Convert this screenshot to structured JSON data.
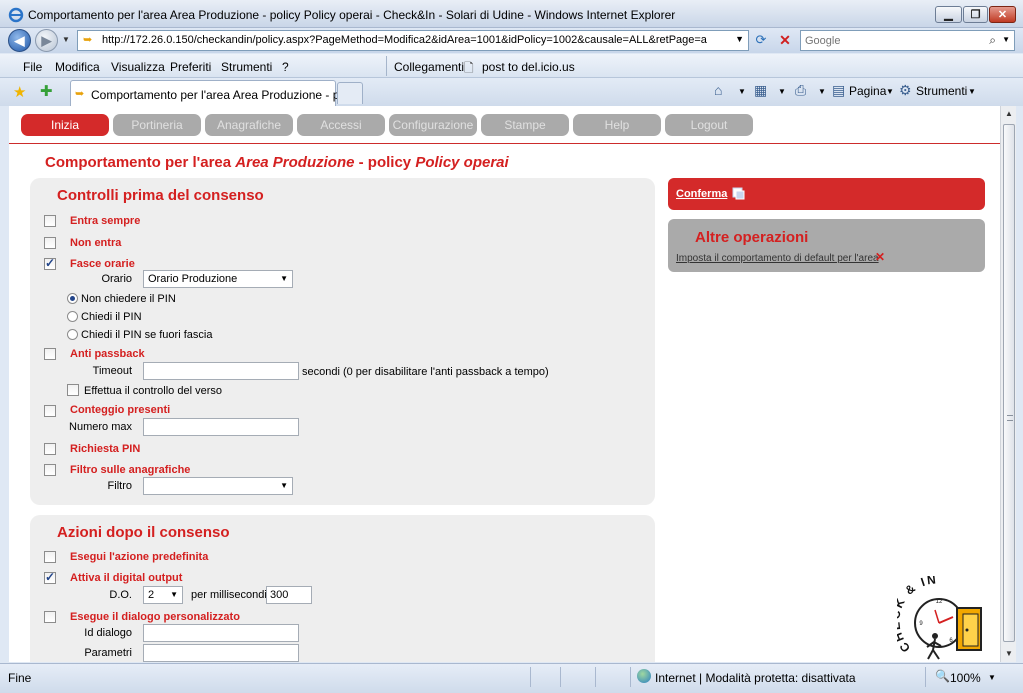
{
  "window": {
    "title": "Comportamento per l'area Area Produzione - policy Policy operai - Check&In - Solari di Udine - Windows Internet Explorer",
    "min_glyph": "▁",
    "max_glyph": "❐",
    "close_glyph": "✕"
  },
  "address": {
    "url": "http://172.26.0.150/checkandin/policy.aspx?PageMethod=Modifica2&idArea=1001&idPolicy=1002&causale=ALL&retPage=a",
    "search_placeholder": "Google"
  },
  "menu": {
    "items": [
      "File",
      "Modifica",
      "Visualizza",
      "Preferiti",
      "Strumenti",
      "?"
    ],
    "links_label": "Collegamenti",
    "link_item": "post to del.icio.us"
  },
  "tabs": {
    "active_label": "Comportamento per l'area Area Produzione - pol...",
    "pagina_label": "Pagina",
    "strumenti_label": "Strumenti"
  },
  "nav": {
    "items": [
      "Inizia",
      "Portineria",
      "Anagrafiche",
      "Accessi",
      "Configurazione",
      "Stampe",
      "Help",
      "Logout"
    ]
  },
  "heading": {
    "prefix": "Comportamento per l'area ",
    "area": "Area Produzione",
    "middle": " - policy ",
    "policy": "Policy operai"
  },
  "controls": {
    "title": "Controlli prima del consenso",
    "entra_sempre": "Entra sempre",
    "non_entra": "Non entra",
    "fasce_orarie": "Fasce orarie",
    "orario_label": "Orario",
    "orario_value": "Orario Produzione",
    "radio_non_chiedere": "Non chiedere il PIN",
    "radio_chiedi": "Chiedi il PIN",
    "radio_fuori_fascia": "Chiedi il PIN se fuori fascia",
    "anti_passback": "Anti passback",
    "timeout_label": "Timeout",
    "timeout_value": "",
    "timeout_hint": "secondi (0 per disabilitare l'anti passback a tempo)",
    "controllo_verso": "Effettua il controllo del verso",
    "conteggio_presenti": "Conteggio presenti",
    "numero_max_label": "Numero max",
    "numero_max_value": "",
    "richiesta_pin": "Richiesta PIN",
    "filtro_anagrafiche": "Filtro sulle anagrafiche",
    "filtro_label": "Filtro",
    "filtro_value": ""
  },
  "actions": {
    "title": "Azioni dopo il consenso",
    "azione_predefinita": "Esegui l'azione predefinita",
    "digital_output": "Attiva il digital output",
    "do_label": "D.O.",
    "do_value": "2",
    "ms_label": "per millisecondi",
    "ms_value": "300",
    "dialogo": "Esegue il dialogo personalizzato",
    "id_dialogo_label": "Id dialogo",
    "id_dialogo_value": "",
    "parametri_label": "Parametri",
    "parametri_value": ""
  },
  "sidebar": {
    "conferma": "Conferma",
    "altre_title": "Altre operazioni",
    "default_link": "Imposta il comportamento di default per l'area"
  },
  "logo": {
    "text": "CHECK & IN"
  },
  "status": {
    "text": "Fine",
    "zone": "Internet | Modalità protetta: disattivata",
    "zoom": "100%"
  },
  "colors": {
    "accent_red": "#d42a2a",
    "nav_gray": "#aaaaaa",
    "panel_bg": "#eeeeee"
  }
}
